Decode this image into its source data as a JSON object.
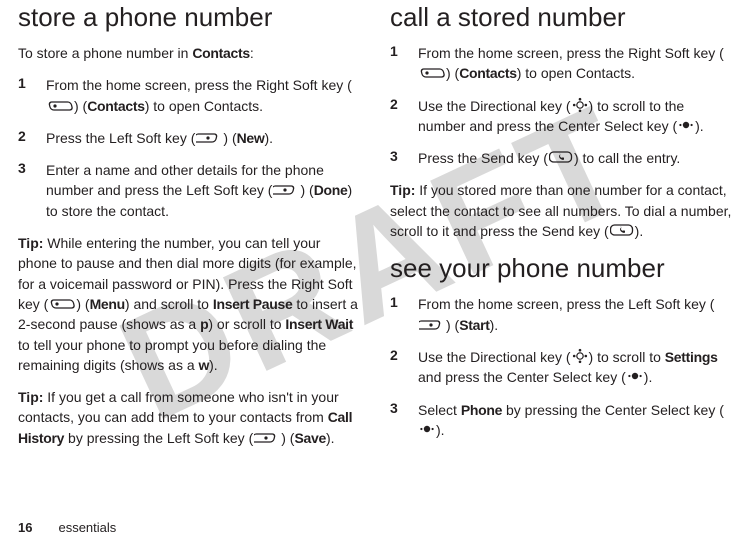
{
  "watermark": "DRAFT",
  "left": {
    "heading": "store a phone number",
    "intro_pre": "To store a phone number in ",
    "intro_bold": "Contacts",
    "intro_post": ":",
    "steps": [
      {
        "n": "1",
        "parts": [
          {
            "t": "From the home screen, press the Right Soft key ("
          },
          {
            "icon": "right-soft-key-icon"
          },
          {
            "t": ") ("
          },
          {
            "b": "Contacts"
          },
          {
            "t": ") to open Contacts."
          }
        ]
      },
      {
        "n": "2",
        "parts": [
          {
            "t": "Press the Left Soft key ("
          },
          {
            "icon": "left-soft-key-icon"
          },
          {
            "t": ") ("
          },
          {
            "b": "New"
          },
          {
            "t": ")."
          }
        ]
      },
      {
        "n": "3",
        "parts": [
          {
            "t": "Enter a name and other details for the phone number and press the Left Soft key ("
          },
          {
            "icon": "left-soft-key-icon"
          },
          {
            "t": ") ("
          },
          {
            "b": "Done"
          },
          {
            "t": ") to store the contact."
          }
        ]
      }
    ],
    "tip1": {
      "label": "Tip:",
      "parts": [
        {
          "t": " While entering the number, you can tell your phone to pause and then dial more digits (for example, for a voicemail password or PIN). Press the Right Soft key ("
        },
        {
          "icon": "right-soft-key-icon"
        },
        {
          "t": ") ("
        },
        {
          "b": "Menu"
        },
        {
          "t": ") and scroll to  "
        },
        {
          "b": "Insert Pause"
        },
        {
          "t": " to insert a 2-second pause (shows as a "
        },
        {
          "b": "p"
        },
        {
          "t": ") or scroll to "
        },
        {
          "b": "Insert Wait"
        },
        {
          "t": " to tell your phone to prompt you before dialing the remaining digits (shows as a "
        },
        {
          "b": "w"
        },
        {
          "t": ")."
        }
      ]
    },
    "tip2": {
      "label": "Tip:",
      "parts": [
        {
          "t": " If you get a call from someone who isn't in your contacts, you can add them to your contacts from "
        },
        {
          "b": "Call History"
        },
        {
          "t": " by pressing the Left Soft key ("
        },
        {
          "icon": "left-soft-key-icon"
        },
        {
          "t": ") ("
        },
        {
          "b": "Save"
        },
        {
          "t": ")."
        }
      ]
    }
  },
  "right": {
    "heading1": "call a stored number",
    "steps1": [
      {
        "n": "1",
        "parts": [
          {
            "t": "From the home screen, press the Right Soft key ("
          },
          {
            "icon": "right-soft-key-icon"
          },
          {
            "t": ") ("
          },
          {
            "b": "Contacts"
          },
          {
            "t": ") to open Contacts."
          }
        ]
      },
      {
        "n": "2",
        "parts": [
          {
            "t": "Use the Directional key ("
          },
          {
            "icon": "directional-key-icon"
          },
          {
            "t": ") to scroll to the number and press the Center Select key ("
          },
          {
            "icon": "center-select-icon"
          },
          {
            "t": ")."
          }
        ]
      },
      {
        "n": "3",
        "parts": [
          {
            "t": "Press the Send key ("
          },
          {
            "icon": "send-key-icon"
          },
          {
            "t": ") to call the entry."
          }
        ]
      }
    ],
    "tip": {
      "label": "Tip:",
      "parts": [
        {
          "t": " If you stored more than one number for a contact, select the contact to see all numbers. To dial a number, scroll to it and press the Send key ("
        },
        {
          "icon": "send-key-icon"
        },
        {
          "t": ")."
        }
      ]
    },
    "heading2": "see your phone number",
    "steps2": [
      {
        "n": "1",
        "parts": [
          {
            "t": "From the home screen, press the Left Soft key ("
          },
          {
            "icon": "left-soft-key-icon"
          },
          {
            "t": ") ("
          },
          {
            "b": "Start"
          },
          {
            "t": ")."
          }
        ]
      },
      {
        "n": "2",
        "parts": [
          {
            "t": "Use the Directional key ("
          },
          {
            "icon": "directional-key-icon"
          },
          {
            "t": ") to scroll to "
          },
          {
            "b": "Settings"
          },
          {
            "t": " and press the Center Select key ("
          },
          {
            "icon": "center-select-icon"
          },
          {
            "t": ")."
          }
        ]
      },
      {
        "n": "3",
        "parts": [
          {
            "t": "Select "
          },
          {
            "b": "Phone"
          },
          {
            "t": " by pressing the Center Select key ("
          },
          {
            "icon": "center-select-icon"
          },
          {
            "t": ")."
          }
        ]
      }
    ]
  },
  "footer": {
    "page": "16",
    "section": "essentials"
  }
}
